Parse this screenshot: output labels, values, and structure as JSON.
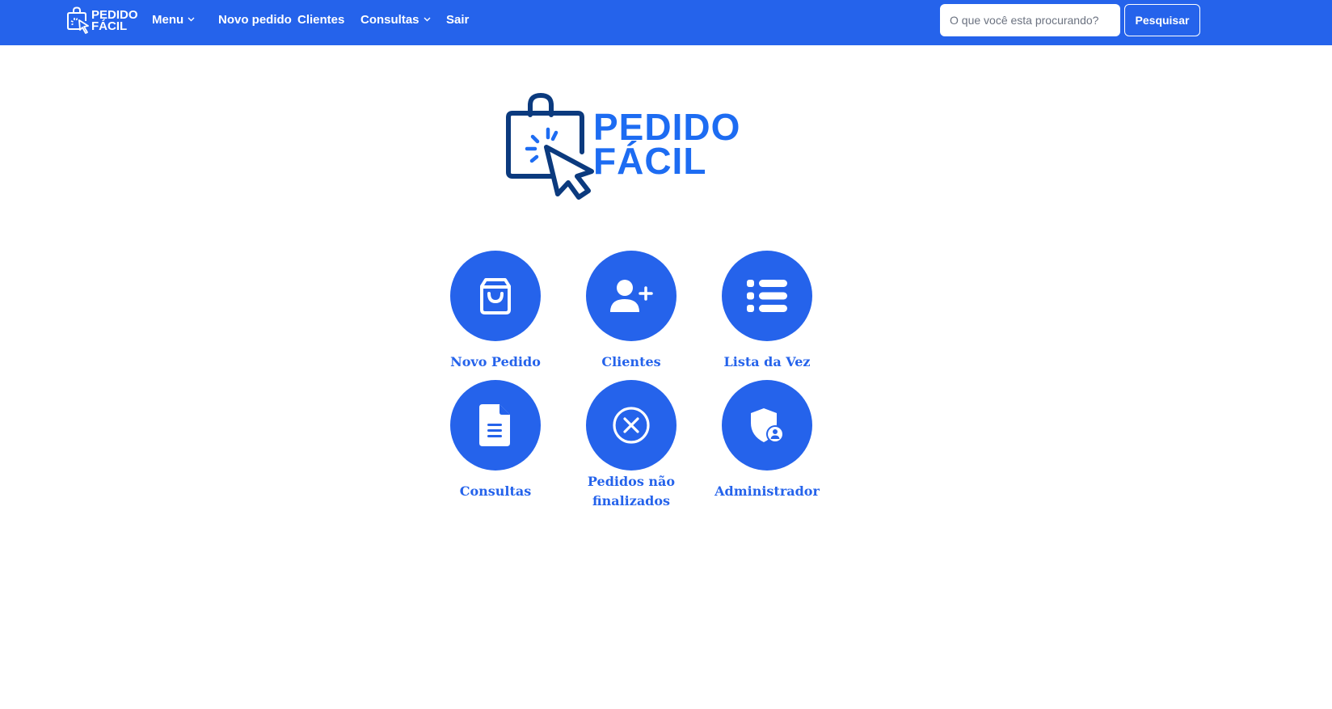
{
  "navbar": {
    "logo_text_top": "PEDIDO",
    "logo_text_bottom": "FÁCIL",
    "items": [
      {
        "label": "Menu",
        "has_dropdown": true
      },
      {
        "label": "Novo pedido",
        "has_dropdown": false
      },
      {
        "label": "Clientes",
        "has_dropdown": false
      },
      {
        "label": "Consultas",
        "has_dropdown": true
      },
      {
        "label": "Sair",
        "has_dropdown": false
      }
    ],
    "search": {
      "placeholder": "O que você esta procurando?",
      "value": "",
      "button_label": "Pesquisar"
    },
    "background_color": "#2563eb"
  },
  "hero": {
    "logo_text_top": "PEDIDO",
    "logo_text_bottom": "FÁCIL",
    "logo_icon": "shopping-bag-cursor-icon",
    "text_color": "#1d6cf2",
    "icon_color": "#0b3a7e"
  },
  "tiles": [
    {
      "label": "Novo Pedido",
      "icon": "shopping-bag-icon"
    },
    {
      "label": "Clientes",
      "icon": "user-plus-icon"
    },
    {
      "label": "Lista da Vez",
      "icon": "list-icon"
    },
    {
      "label": "Consultas",
      "icon": "document-icon"
    },
    {
      "label_line1": "Pedidos não",
      "label_line2": "finalizados",
      "icon": "x-circle-icon"
    },
    {
      "label": "Administrador",
      "icon": "shield-user-icon"
    }
  ],
  "colors": {
    "accent": "#2563eb",
    "white": "#ffffff"
  }
}
